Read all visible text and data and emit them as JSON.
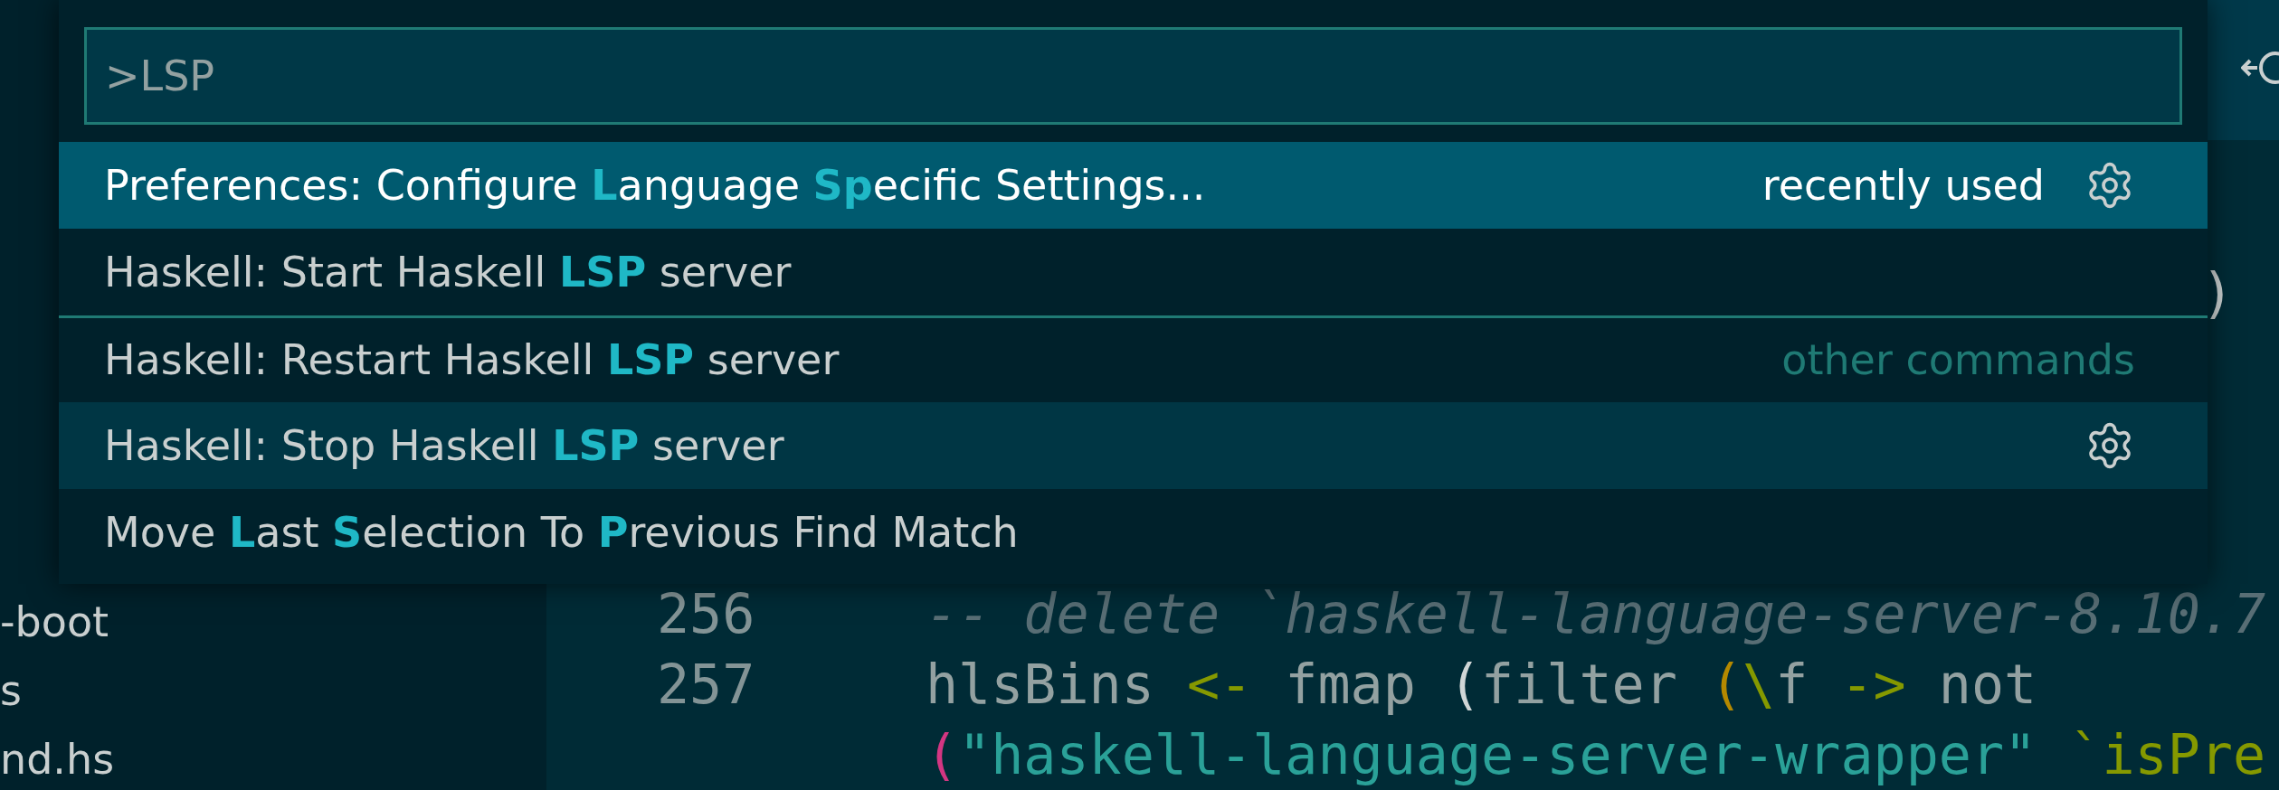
{
  "command_palette": {
    "input": {
      "value": ">LSP"
    },
    "items": [
      {
        "segments": [
          {
            "text": "Preferences: Configure ",
            "match": false
          },
          {
            "text": "L",
            "match": true
          },
          {
            "text": "anguage ",
            "match": false
          },
          {
            "text": "Sp",
            "match": true
          },
          {
            "text": "ecific Settings...",
            "match": false
          }
        ],
        "description": "recently used",
        "selected": true,
        "hovered": false,
        "gear": true,
        "separator": false
      },
      {
        "segments": [
          {
            "text": "Haskell: Start Haskell ",
            "match": false
          },
          {
            "text": "LSP",
            "match": true
          },
          {
            "text": " server",
            "match": false
          }
        ],
        "selected": false,
        "hovered": false,
        "gear": false,
        "separator": false
      },
      {
        "segments": [
          {
            "text": "Haskell: Restart Haskell ",
            "match": false
          },
          {
            "text": "LSP",
            "match": true
          },
          {
            "text": " server",
            "match": false
          }
        ],
        "description": "other commands",
        "selected": false,
        "hovered": false,
        "gear": false,
        "separator": true
      },
      {
        "segments": [
          {
            "text": "Haskell: Stop Haskell ",
            "match": false
          },
          {
            "text": "LSP",
            "match": true
          },
          {
            "text": " server",
            "match": false
          }
        ],
        "selected": false,
        "hovered": true,
        "gear": true,
        "separator": false
      },
      {
        "segments": [
          {
            "text": "Move ",
            "match": false
          },
          {
            "text": "L",
            "match": true
          },
          {
            "text": "ast ",
            "match": false
          },
          {
            "text": "S",
            "match": true
          },
          {
            "text": "election To ",
            "match": false
          },
          {
            "text": "P",
            "match": true
          },
          {
            "text": "revious Find Match",
            "match": false
          }
        ],
        "selected": false,
        "hovered": false,
        "gear": false,
        "separator": false
      }
    ]
  },
  "explorer": {
    "items": [
      {
        "label": "-boot"
      },
      {
        "label": "s"
      },
      {
        "label": "nd.hs"
      }
    ]
  },
  "editor": {
    "partial_line": ")",
    "lines": [
      {
        "number": "256",
        "tokens": [
          {
            "text": "-- delete `haskell-language-server-8.10.7",
            "kind": "comment"
          }
        ]
      },
      {
        "number": "257",
        "tokens": [
          {
            "text": "hlsBins ",
            "kind": "plain"
          },
          {
            "text": "<-",
            "kind": "operator"
          },
          {
            "text": " fmap ",
            "kind": "plain"
          },
          {
            "text": "(",
            "kind": "bracket"
          },
          {
            "text": "filter ",
            "kind": "plain"
          },
          {
            "text": "(",
            "kind": "bracket2"
          },
          {
            "text": "\\",
            "kind": "operator"
          },
          {
            "text": "f ",
            "kind": "plain"
          },
          {
            "text": "->",
            "kind": "operator"
          },
          {
            "text": " not",
            "kind": "plain"
          }
        ]
      },
      {
        "tokens": [
          {
            "text": "(",
            "kind": "bracket3"
          },
          {
            "text": "\"haskell-language-server-wrapper\"",
            "kind": "string"
          },
          {
            "text": " `isPre",
            "kind": "function"
          }
        ]
      }
    ]
  }
}
